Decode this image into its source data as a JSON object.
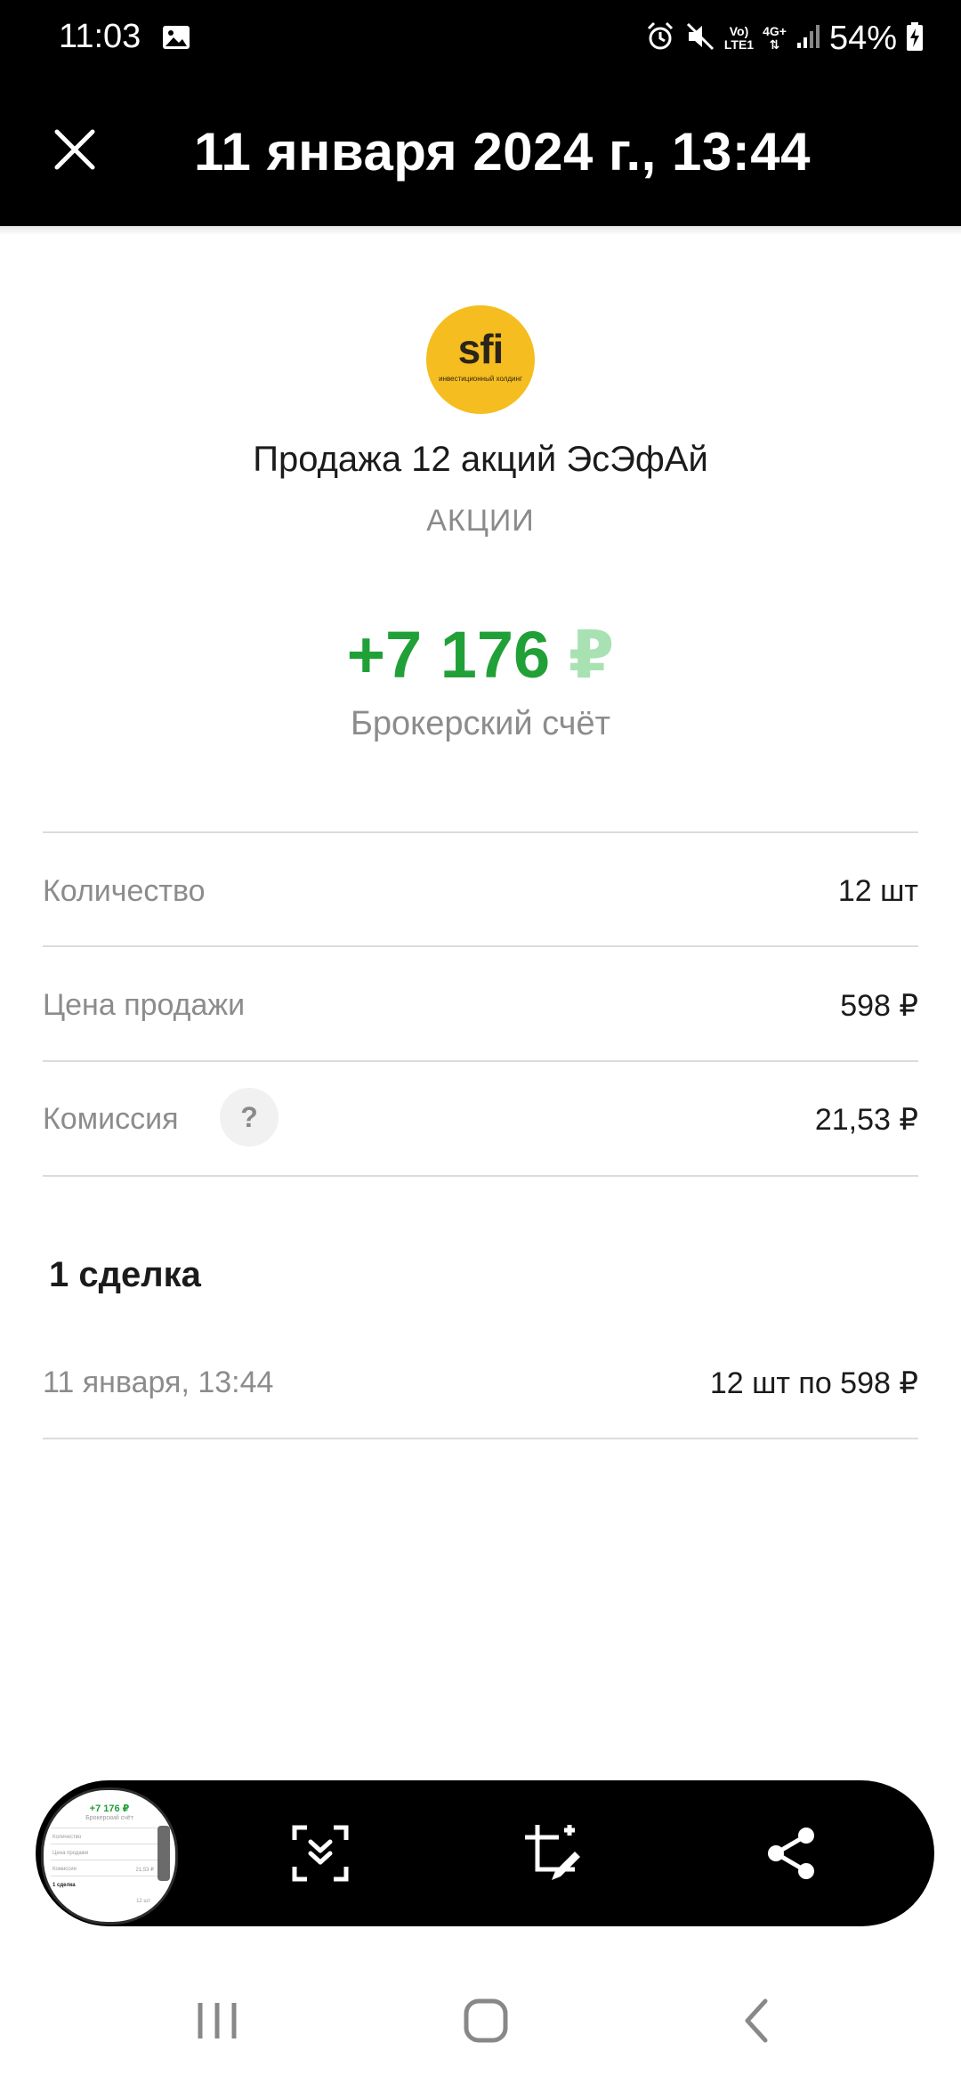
{
  "status_bar": {
    "time": "11:03",
    "network_top": "Vo)",
    "network_bottom": "LTE1",
    "data_type": "4G+",
    "battery": "54%"
  },
  "header": {
    "title": "11 января 2024 г., 13:44",
    "close_icon": "close-icon"
  },
  "operation": {
    "logo_text": "sfi",
    "logo_subtext": "инвестиционный холдинг",
    "title": "Продажа 12 акций ЭсЭфАй",
    "category": "АКЦИИ",
    "amount": "+7 176",
    "currency": "₽",
    "account": "Брокерский счёт"
  },
  "details": {
    "rows": [
      {
        "label": "Количество",
        "value": "12 шт"
      },
      {
        "label": "Цена продажи",
        "value": "598 ₽"
      },
      {
        "label": "Комиссия",
        "value": "21,53 ₽"
      }
    ],
    "help_symbol": "?"
  },
  "deals": {
    "heading": "1 сделка",
    "items": [
      {
        "time": "11 января, 13:44",
        "summary": "12 шт по 598 ₽"
      }
    ]
  },
  "screenshot_toolbar": {
    "thumbnail": {
      "amount": "+7 176 ₽",
      "subtitle": "Брокерский счёт",
      "row1": "Количество",
      "row2": "Цена продажи",
      "row3": "Комиссия",
      "row3_value": "21,53 ₽",
      "heading": "1 сделка",
      "deal": "12 шт"
    },
    "icons": [
      "scroll-capture-icon",
      "crop-edit-icon",
      "share-icon"
    ]
  },
  "navigation": {
    "icons": [
      "recent-apps-icon",
      "home-icon",
      "back-icon"
    ]
  },
  "colors": {
    "accent_green": "#21a038",
    "currency_green_light": "#a8e2b3",
    "logo_yellow": "#f5bd1f",
    "header_bg": "#000000"
  }
}
